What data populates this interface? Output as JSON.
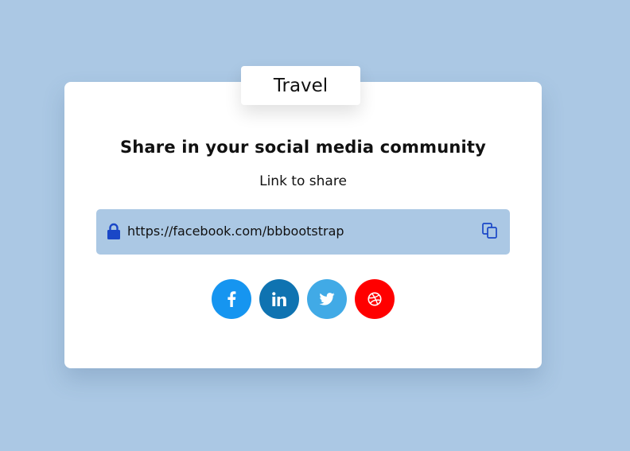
{
  "tab": {
    "label": "Travel"
  },
  "card": {
    "title": "Share in your social media community",
    "subtitle": "Link to share",
    "link_value": "https://facebook.com/bbbootstrap"
  },
  "icons": {
    "lock": "lock-icon",
    "copy": "copy-icon",
    "facebook": "facebook-icon",
    "linkedin": "linkedin-icon",
    "twitter": "twitter-icon",
    "dribbble": "dribbble-icon"
  },
  "colors": {
    "background": "#abc8e4",
    "accent": "#1a47c7",
    "facebook": "#1695f0",
    "linkedin": "#0f73b1",
    "twitter": "#41aae6",
    "dribbble": "#ff0000"
  }
}
